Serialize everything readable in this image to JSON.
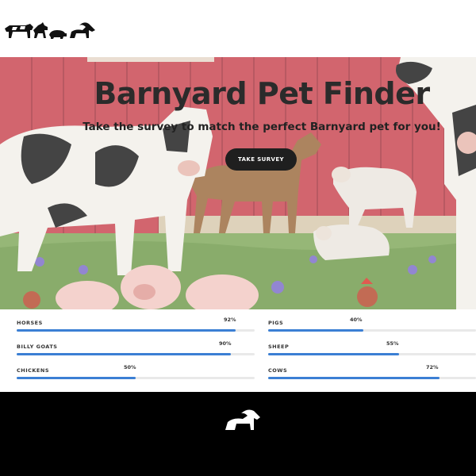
{
  "header": {
    "logo_icon": "farm-animals-logo-icon"
  },
  "hero": {
    "title": "Barnyard Pet Finder",
    "subtitle": "Take the survey to match the perfect Barnyard pet for you!",
    "button_label": "TAKE SURVEY"
  },
  "stats": {
    "left": [
      {
        "label": "HORSES",
        "percent_text": "92%",
        "percent": 92
      },
      {
        "label": "BILLY GOATS",
        "percent_text": "90%",
        "percent": 90
      },
      {
        "label": "CHICKENS",
        "percent_text": "50%",
        "percent": 50
      }
    ],
    "right": [
      {
        "label": "PIGS",
        "percent_text": "40%",
        "percent": 40
      },
      {
        "label": "SHEEP",
        "percent_text": "55%",
        "percent": 55
      },
      {
        "label": "COWS",
        "percent_text": "72%",
        "percent": 72
      }
    ],
    "bar_color": "#3b7fd4",
    "track_color": "#e9e9e9"
  },
  "footer": {
    "logo_icon": "goat-logo-icon"
  }
}
